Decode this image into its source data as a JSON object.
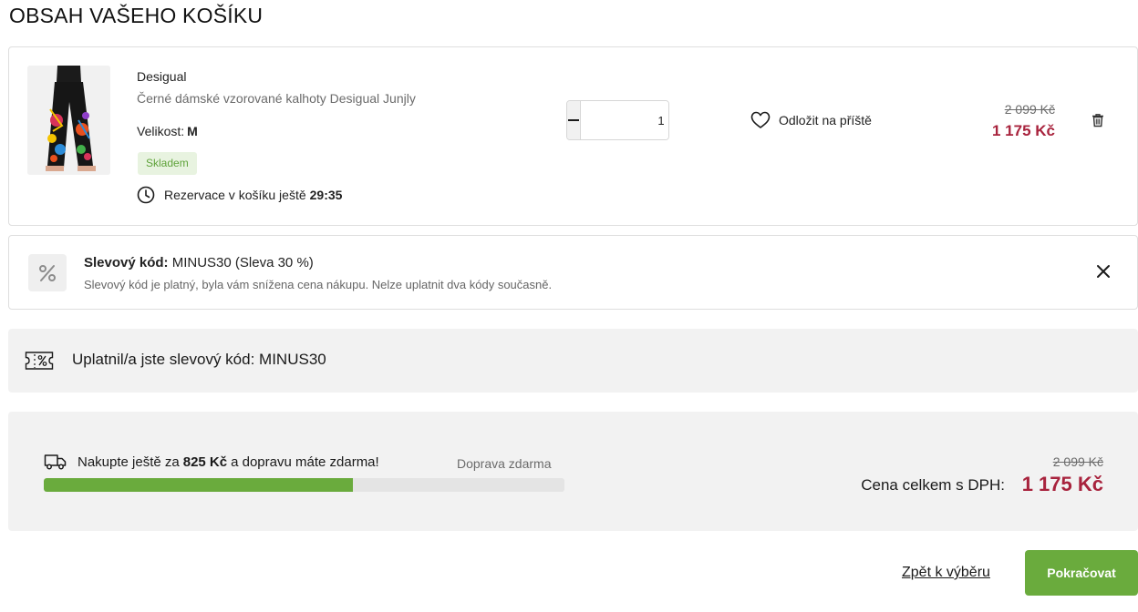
{
  "page": {
    "title": "OBSAH VAŠEHO KOŠÍKU"
  },
  "cart_item": {
    "image_icon": "pants-product-photo",
    "brand": "Desigual",
    "name": "Černé dámské vzorované kalhoty Desigual Junjly",
    "size_label": "Velikost:",
    "size_value": "M",
    "stock": "Skladem",
    "reservation_text": "Rezervace v košíku ještě",
    "reservation_time": "29:35",
    "quantity": "1",
    "save_later": "Odložit na příště",
    "old_price": "2 099 Kč",
    "price": "1 175 Kč",
    "colors": {
      "price": "#a8233d",
      "stock": "#5fa33a"
    }
  },
  "discount": {
    "title_label": "Slevový kód:",
    "title_value": "MINUS30 (Sleva 30 %)",
    "description": "Slevový kód je platný, byla vám snížena cena nákupu. Nelze uplatnit dva kódy současně."
  },
  "applied": {
    "text": "Uplatnil/a jste slevový kód: MINUS30"
  },
  "summary": {
    "ship_prefix": "Nakupte ještě za",
    "ship_amount": "825 Kč",
    "ship_suffix": "a dopravu máte zdarma!",
    "ship_free_label": "Doprava zdarma",
    "ship_progress_percent": 59.3,
    "old_total": "2 099 Kč",
    "total_label": "Cena celkem s DPH:",
    "total": "1 175 Kč",
    "colors": {
      "progress": "#6aab3d",
      "total": "#a8233d"
    }
  },
  "actions": {
    "back_label": "Zpět k výběru",
    "continue_label": "Pokračovat"
  }
}
